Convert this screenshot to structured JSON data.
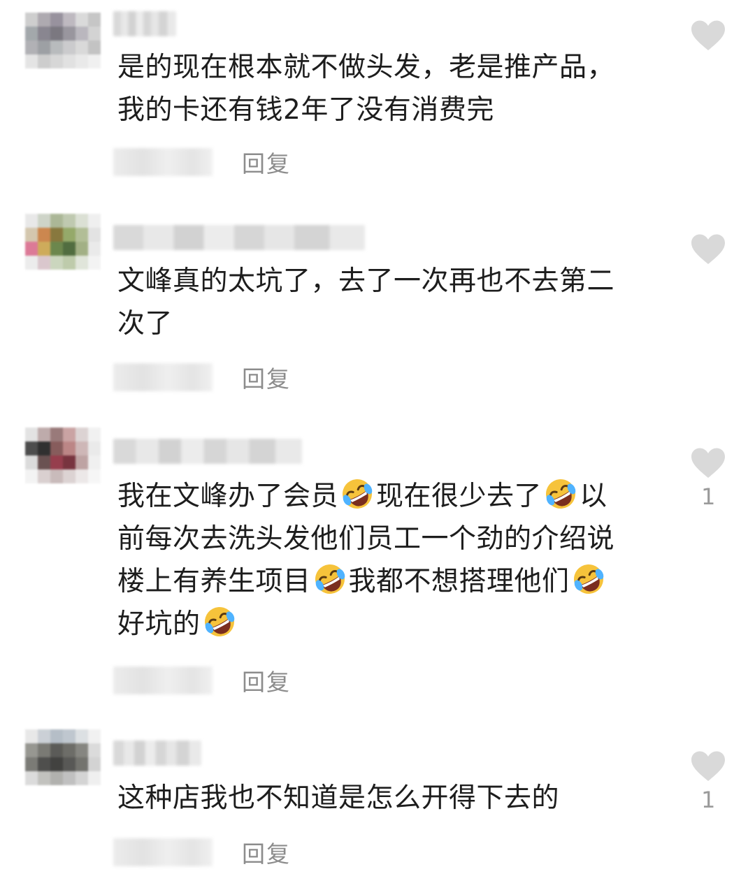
{
  "comments": [
    {
      "lines": [
        [
          {
            "t": "是的现在根本就不做头发，老是推产品，"
          }
        ],
        [
          {
            "t": "我的卡还有钱2年了没有消费完"
          }
        ]
      ],
      "reply_label": "回复",
      "likes": ""
    },
    {
      "lines": [
        [
          {
            "t": "文峰真的太坑了，去了一次再也不去第二"
          }
        ],
        [
          {
            "t": "次了"
          }
        ]
      ],
      "reply_label": "回复",
      "likes": ""
    },
    {
      "lines": [
        [
          {
            "t": "我在文峰办了会员"
          },
          {
            "e": "rofl-emoji"
          },
          {
            "t": "现在很少去了"
          },
          {
            "e": "rofl-emoji"
          },
          {
            "t": "以"
          }
        ],
        [
          {
            "t": "前每次去洗头发他们员工一个劲的介绍说"
          }
        ],
        [
          {
            "t": "楼上有养生项目"
          },
          {
            "e": "rofl-emoji"
          },
          {
            "t": "我都不想搭理他们"
          },
          {
            "e": "rofl-emoji"
          }
        ],
        [
          {
            "t": "好坑的"
          },
          {
            "e": "rofl-emoji"
          }
        ]
      ],
      "reply_label": "回复",
      "likes": "1"
    },
    {
      "lines": [
        [
          {
            "t": "这种店我也不知道是怎么开得下去的"
          }
        ]
      ],
      "reply_label": "回复",
      "likes": "1"
    }
  ],
  "icons": {
    "like": "heart-icon",
    "emoji": "rolling-on-floor-laughing-emoji"
  },
  "colors": {
    "text": "#1d1d1d",
    "reply": "#8c8c8c",
    "heart": "#d9d9d9",
    "count": "#9a9a9a"
  }
}
